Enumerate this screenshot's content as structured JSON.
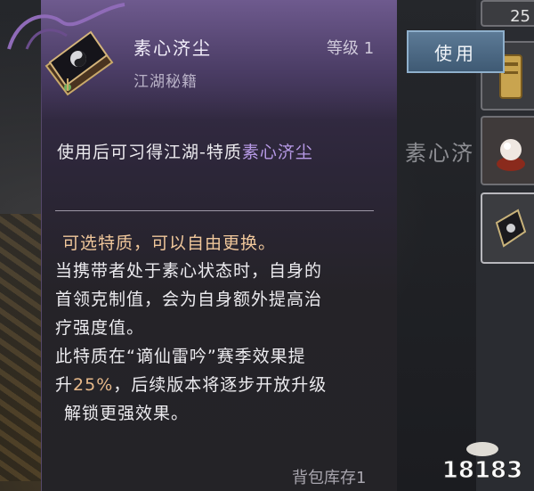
{
  "tooltip": {
    "item_name": "素心济尘",
    "item_type": "江湖秘籍",
    "level_label": "等级 1",
    "use_effect_prefix": "使用后可习得江湖-特质",
    "use_effect_highlight": "素心济尘",
    "trait_note": "可选特质，可以自由更换。",
    "description_lines": [
      "当携带者处于素心状态时，自身的",
      "首领克制值，会为自身额外提高治",
      "疗强度值。",
      "此特质在“谪仙雷吟”赛季效果提"
    ],
    "line5_prefix": "升",
    "line5_percent": "25%",
    "line5_suffix": "，后续版本将逐步开放升级",
    "line6": "解锁更强效果。",
    "inventory_text": "背包库存1"
  },
  "actions": {
    "use_button": "使用"
  },
  "side_slots": {
    "top_count": "25",
    "slot_label": "素心济"
  },
  "watermark": {
    "text": "18183"
  },
  "colors": {
    "highlight_purple": "#b79ae6",
    "trait_orange": "#f0c79b",
    "percent_orange": "#e7b98a",
    "button_blue": "#4f6c88"
  },
  "icons": {
    "item_icon": "secret-manual-book-icon",
    "slot_items": [
      "scroll-item-icon",
      "pearl-item-icon",
      "secret-manual-book-icon"
    ]
  }
}
